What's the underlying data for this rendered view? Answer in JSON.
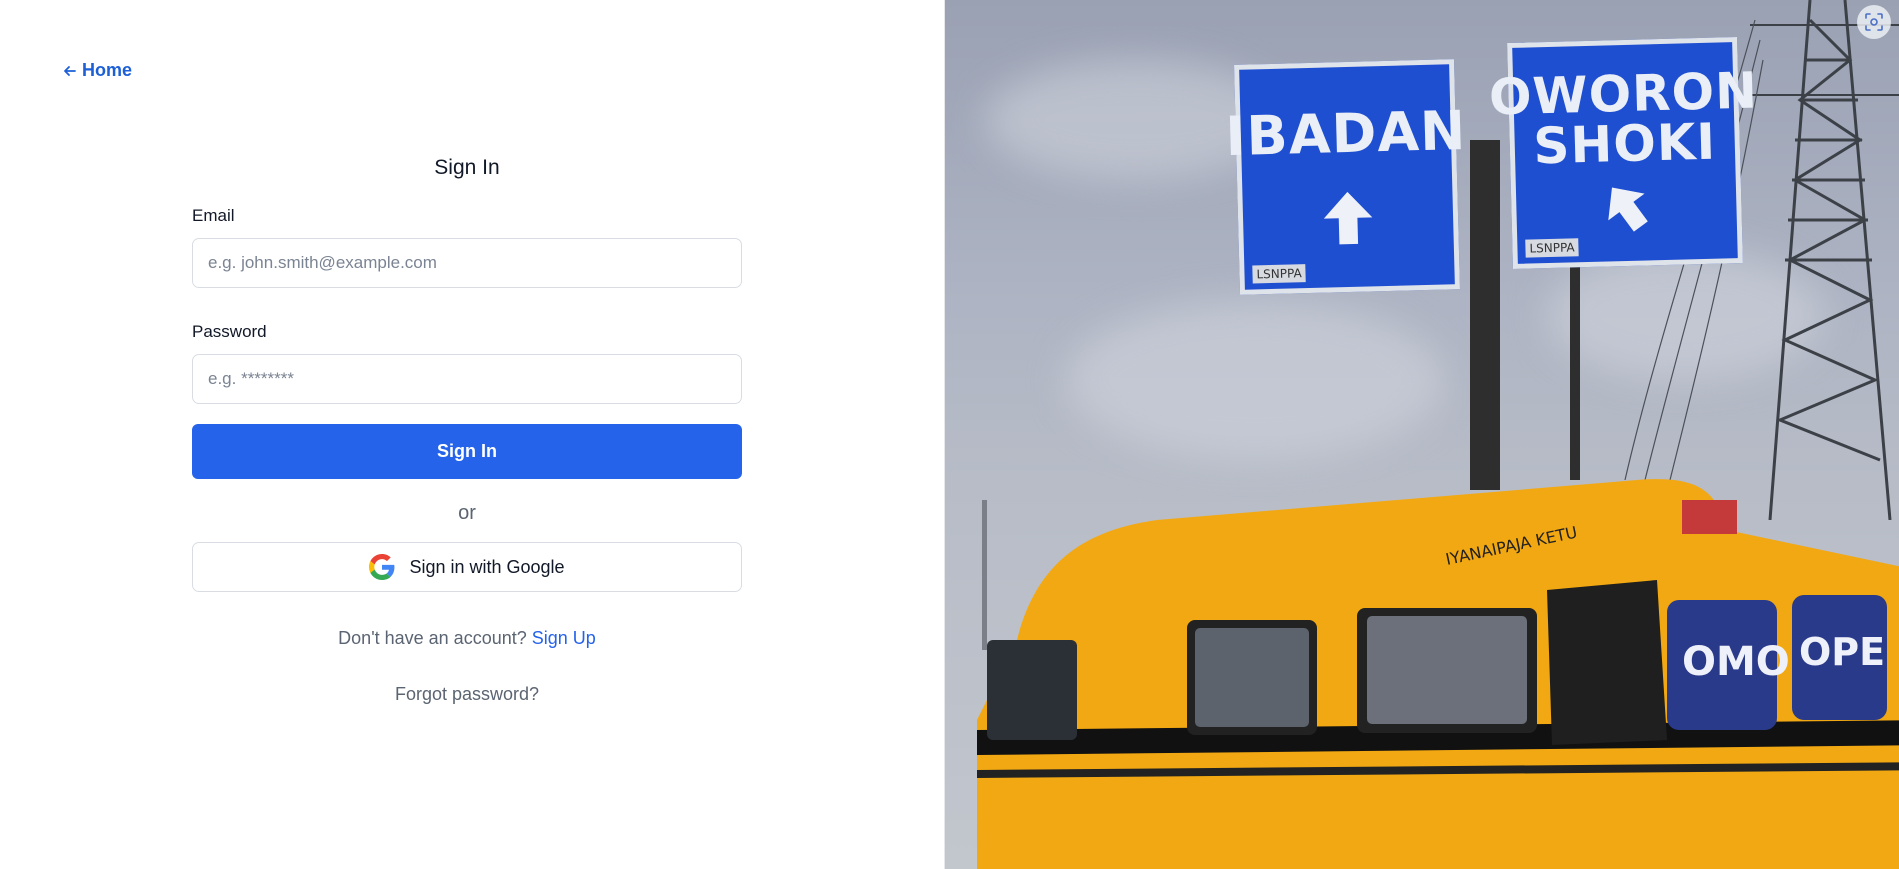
{
  "nav": {
    "home_label": "Home"
  },
  "form": {
    "title": "Sign In",
    "email_label": "Email",
    "email_placeholder": "e.g. john.smith@example.com",
    "password_label": "Password",
    "password_placeholder": "e.g. ********",
    "submit_label": "Sign In",
    "or_label": "or",
    "google_label": "Sign in with Google",
    "no_account_text": "Don't have an account?",
    "signup_label": "Sign Up",
    "forgot_label": "Forgot password?"
  },
  "photo": {
    "sign_left_text": "IBADAN",
    "sign_right_text_line1": "OWORON",
    "sign_right_text_line2": "SHOKI",
    "sign_tag": "LSNPPA",
    "bus_text_1": "OMO",
    "bus_text_2": "OPE",
    "bus_script": "IYANAIPAJA KETU"
  },
  "colors": {
    "accent": "#2563eb",
    "link": "#1d5fd6",
    "muted": "#5b6472",
    "bus_yellow": "#f2a812",
    "sign_blue": "#1f4fd1"
  },
  "icons": {
    "home": "arrow-left-icon",
    "google": "google-icon",
    "scan": "scan-icon"
  }
}
